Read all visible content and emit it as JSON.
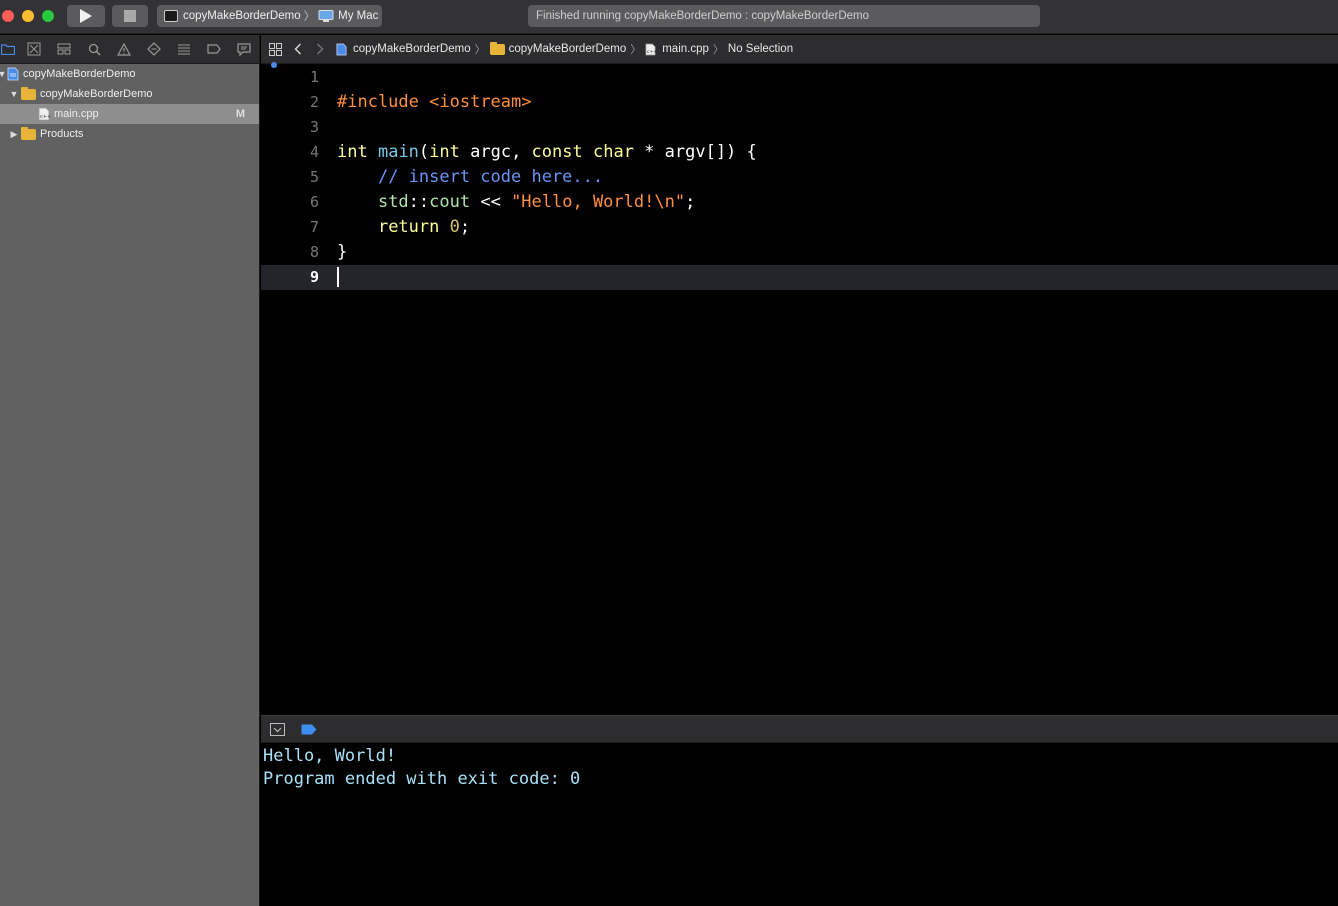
{
  "toolbar": {
    "scheme_name": "copyMakeBorderDemo",
    "destination": "My Mac",
    "status": "Finished running copyMakeBorderDemo : copyMakeBorderDemo"
  },
  "navigator": {
    "items": [
      {
        "label": "copyMakeBorderDemo",
        "kind": "project"
      },
      {
        "label": "copyMakeBorderDemo",
        "kind": "folder"
      },
      {
        "label": "main.cpp",
        "kind": "file",
        "badge": "M"
      },
      {
        "label": "Products",
        "kind": "folder"
      }
    ]
  },
  "jumpbar": {
    "crumbs": [
      "copyMakeBorderDemo",
      "copyMakeBorderDemo",
      "main.cpp",
      "No Selection"
    ]
  },
  "editor": {
    "line_numbers": [
      "1",
      "2",
      "3",
      "4",
      "5",
      "6",
      "7",
      "8",
      "9"
    ],
    "current_line": 9,
    "tokens": {
      "include_kw": "#include",
      "include_hdr": "<iostream>",
      "int1": "int",
      "main": "main",
      "paren_open": "(",
      "int2": "int",
      "argc": " argc, ",
      "const": "const",
      "char": "char",
      "argv": " * argv[]) {",
      "comment": "// insert code here...",
      "std": "std",
      "scope": "::",
      "cout": "cout",
      "shift": " << ",
      "string": "\"Hello, World!\\n\"",
      "semi1": ";",
      "return": "return",
      "zero": "0",
      "semi2": ";",
      "brace_close": "}"
    }
  },
  "console": {
    "lines": [
      "Hello, World!",
      "Program ended with exit code: 0"
    ]
  },
  "colors": {
    "keyword": "#fdfd96",
    "preprocessor": "#fd8f3f",
    "comment": "#6c94f5",
    "console_text": "#a9e2f8",
    "accent": "#4a8ae8"
  }
}
